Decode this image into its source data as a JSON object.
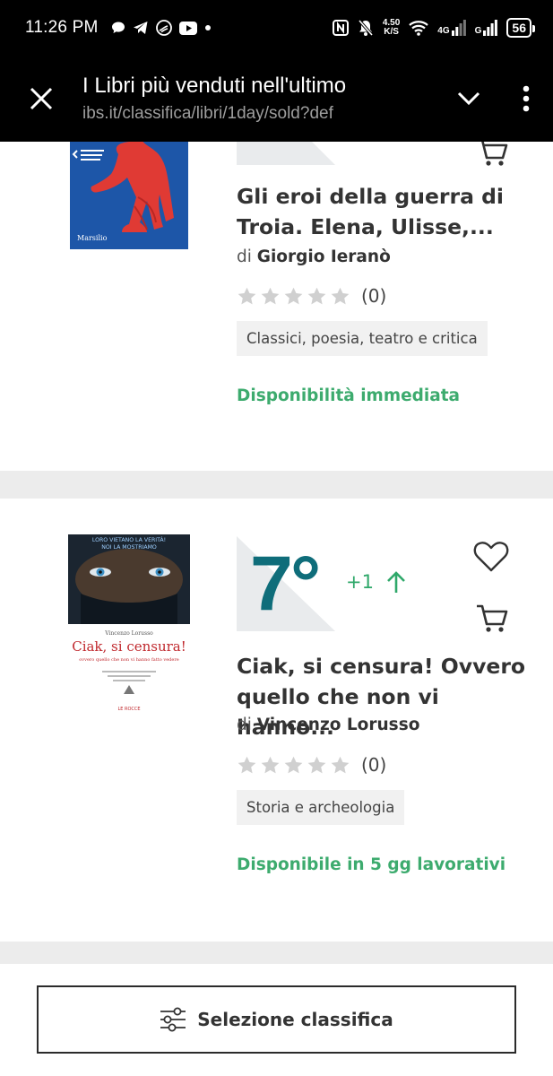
{
  "status_bar": {
    "time": "11:26 PM",
    "net_speed_value": "4.50",
    "net_speed_unit": "K/S",
    "network_1": "4G",
    "network_2": "G",
    "battery": "56"
  },
  "browser": {
    "page_title": "I Libri più venduti nell'ultimo",
    "url": "ibs.it/classifica/libri/1day/sold?def"
  },
  "books": [
    {
      "title": "Gli eroi della guerra di Troia. Elena, Ulisse,...",
      "author_prefix": "di",
      "author": "Giorgio Ieranò",
      "rating_count": "(0)",
      "category": "Classici, poesia, teatro e critica",
      "availability": "Disponibilità immediata",
      "cover_publisher": "Marsilio"
    },
    {
      "rank": "7°",
      "rank_change": "+1",
      "title": "Ciak, si censura! Ovvero quello che non vi hanno...",
      "author_prefix": "di",
      "author": "Vincenzo Lorusso",
      "rating_count": "(0)",
      "category": "Storia e archeologia",
      "availability": "Disponibile in 5 gg lavorativi",
      "cover_banner_1": "LORO VIETANO LA VERITÀ!",
      "cover_banner_2": "NOI LA MOSTRIAMO",
      "cover_author": "Vincenzo Lorusso",
      "cover_title": "Ciak, si censura!",
      "cover_subtitle": "ovvero quello che non vi hanno fatto vedere",
      "cover_publisher": "LE ROCCE"
    }
  ],
  "bottom": {
    "select_label": "Selezione classifica"
  },
  "colors": {
    "rank": "#0f6d7a",
    "green": "#3dab6e",
    "background": "#ececec"
  }
}
